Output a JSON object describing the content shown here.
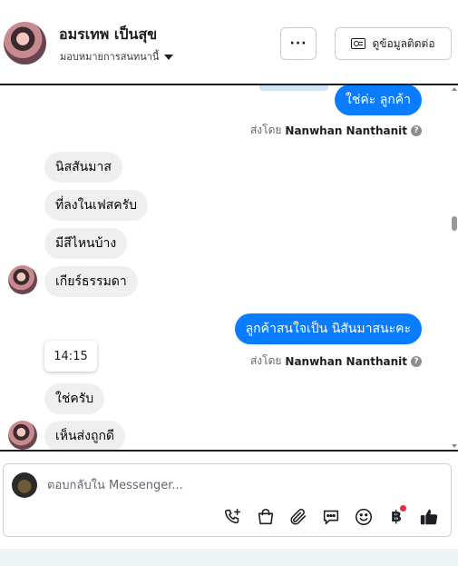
{
  "header": {
    "contact_name": "อมรเทพ เป็นสุข",
    "assign_label": "มอบหมายการสนทนานี้",
    "more_label": "···",
    "contact_button_label": "ดูข้อมูลติดต่อ"
  },
  "messages": {
    "out_1": "ใช่ค่ะ  ลูกค้า",
    "sent_by_prefix": "ส่งโดย",
    "sent_by_name": "Nanwhan Nanthanit",
    "in_1": "นิสสันมาส",
    "in_2": "ที่ลงในเฟสครับ",
    "in_3": "มีสีไหนบ้าง",
    "in_4": "เกียร์ธรรมดา",
    "out_2": "ลูกค้าสนใจเป็น นิสันมาสนะคะ",
    "time": "14:15",
    "in_5": "ใช่ครับ",
    "in_6": "เห็นส่งถูกดี"
  },
  "composer": {
    "placeholder": "ตอบกลับใน Messenger..."
  },
  "icons": [
    "call-add-icon",
    "shopping-bag-icon",
    "attachment-icon",
    "saved-reply-icon",
    "emoji-icon",
    "baht-icon",
    "like-icon"
  ],
  "colors": {
    "accent": "#0a7cff",
    "incoming_bubble": "#efefef",
    "notification": "#f02849"
  }
}
